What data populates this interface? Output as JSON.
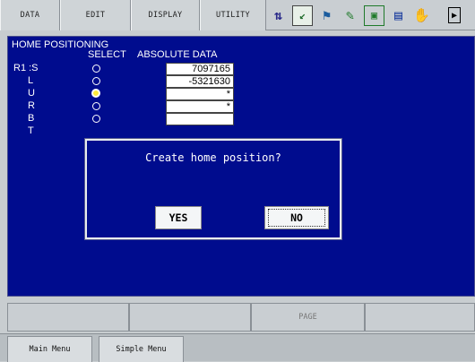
{
  "menu": {
    "tabs": [
      "DATA",
      "EDIT",
      "DISPLAY",
      "UTILITY"
    ]
  },
  "status_icons": [
    "speed-level-icon",
    "coordinate-icon",
    "teach-mode-icon",
    "security-icon",
    "job-icon",
    "servo-icon",
    "hand-icon",
    "cursor-arrow-icon"
  ],
  "screen": {
    "title": "HOME POSITIONING",
    "col_select": "SELECT",
    "col_absolute": "ABSOLUTE DATA",
    "group": "R1 :S",
    "axes": [
      {
        "label": "",
        "value": "7097165",
        "selected": false
      },
      {
        "label": "L",
        "value": "-5321630",
        "selected": false
      },
      {
        "label": "U",
        "value": "*",
        "selected": true
      },
      {
        "label": "R",
        "value": "*",
        "selected": false
      },
      {
        "label": "B",
        "value": "",
        "selected": false
      },
      {
        "label": "T",
        "value": "",
        "selected": false
      }
    ]
  },
  "dialog": {
    "message": "Create home position?",
    "yes": "YES",
    "no": "NO"
  },
  "function_keys": [
    "",
    "",
    "",
    "PAGE",
    ""
  ],
  "bottom": {
    "main_menu": "Main Menu",
    "simple_menu": "Simple Menu"
  },
  "colors": {
    "screen_bg": "#000c8e",
    "selected_radio": "#ffeb3b"
  }
}
